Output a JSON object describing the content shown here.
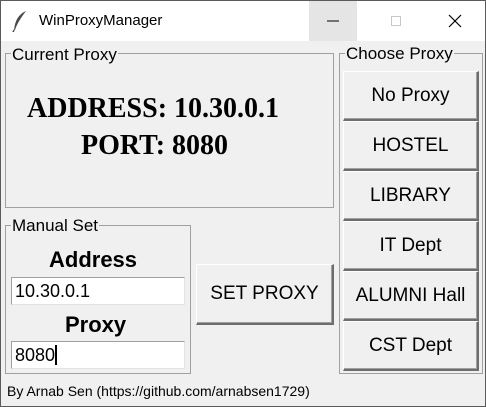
{
  "window": {
    "title": "WinProxyManager"
  },
  "current_proxy": {
    "group_label": "Current Proxy",
    "address_text": "ADDRESS: 10.30.0.1",
    "port_text": "PORT: 8080"
  },
  "manual_set": {
    "group_label": "Manual Set",
    "address_label": "Address",
    "address_value": "10.30.0.1",
    "proxy_label": "Proxy",
    "proxy_value": "8080"
  },
  "set_proxy_button": "SET PROXY",
  "choose_proxy": {
    "group_label": "Choose Proxy",
    "options": [
      "No Proxy",
      "HOSTEL",
      "LIBRARY",
      "IT Dept",
      "ALUMNI Hall",
      "CST Dept"
    ]
  },
  "footer": "By Arnab Sen (https://github.com/arnabsen1729)",
  "icons": [
    "feather-icon",
    "minimize-icon",
    "maximize-icon",
    "close-icon"
  ]
}
